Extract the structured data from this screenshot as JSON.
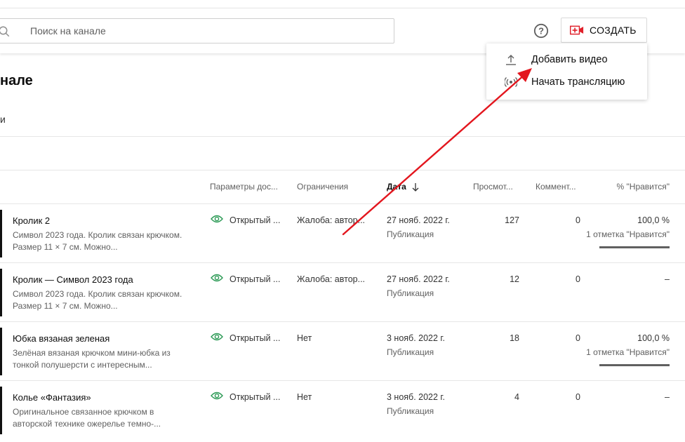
{
  "header": {
    "search_placeholder": "Поиск на канале",
    "create_label": "СОЗДАТЬ"
  },
  "create_menu": {
    "items": [
      {
        "label": "Добавить видео",
        "icon": "upload-icon"
      },
      {
        "label": "Начать трансляцию",
        "icon": "live-icon"
      }
    ]
  },
  "page": {
    "title": "нале",
    "subtab": "и"
  },
  "table": {
    "columns": {
      "visibility": "Параметры дос...",
      "restrictions": "Ограничения",
      "date": "Дата",
      "views": "Просмот...",
      "comments": "Коммент...",
      "likes": "% \"Нравится\""
    },
    "rows": [
      {
        "title": "Кролик 2",
        "description": "Символ 2023 года. Кролик связан крючком. Размер 11 × 7 см. Можно...",
        "visibility": "Открытый ...",
        "restrictions": "Жалоба: автор...",
        "date": "27 нояб. 2022 г.",
        "status": "Публикация",
        "views": "127",
        "comments": "0",
        "likes": "100,0 %",
        "likes_sub": "1 отметка \"Нравится\""
      },
      {
        "title": "Кролик — Символ 2023 года",
        "description": "Символ 2023 года. Кролик связан крючком. Размер 11 × 7 см. Можно...",
        "visibility": "Открытый ...",
        "restrictions": "Жалоба: автор...",
        "date": "27 нояб. 2022 г.",
        "status": "Публикация",
        "views": "12",
        "comments": "0",
        "likes": "–",
        "likes_sub": ""
      },
      {
        "title": "Юбка вязаная зеленая",
        "description": "Зелёная вязаная крючком мини-юбка из тонкой полушерсти с интересным...",
        "visibility": "Открытый ...",
        "restrictions": "Нет",
        "date": "3 нояб. 2022 г.",
        "status": "Публикация",
        "views": "18",
        "comments": "0",
        "likes": "100,0 %",
        "likes_sub": "1 отметка \"Нравится\""
      },
      {
        "title": "Колье «Фантазия»",
        "description": "Оригинальное связанное крючком в авторской технике ожерелье темно-...",
        "visibility": "Открытый ...",
        "restrictions": "Нет",
        "date": "3 нояб. 2022 г.",
        "status": "Публикация",
        "views": "4",
        "comments": "0",
        "likes": "–",
        "likes_sub": ""
      }
    ]
  },
  "colors": {
    "accent_red": "#e0202a",
    "eye_green": "#2e9b57",
    "annotation_arrow": "#e3161e"
  }
}
